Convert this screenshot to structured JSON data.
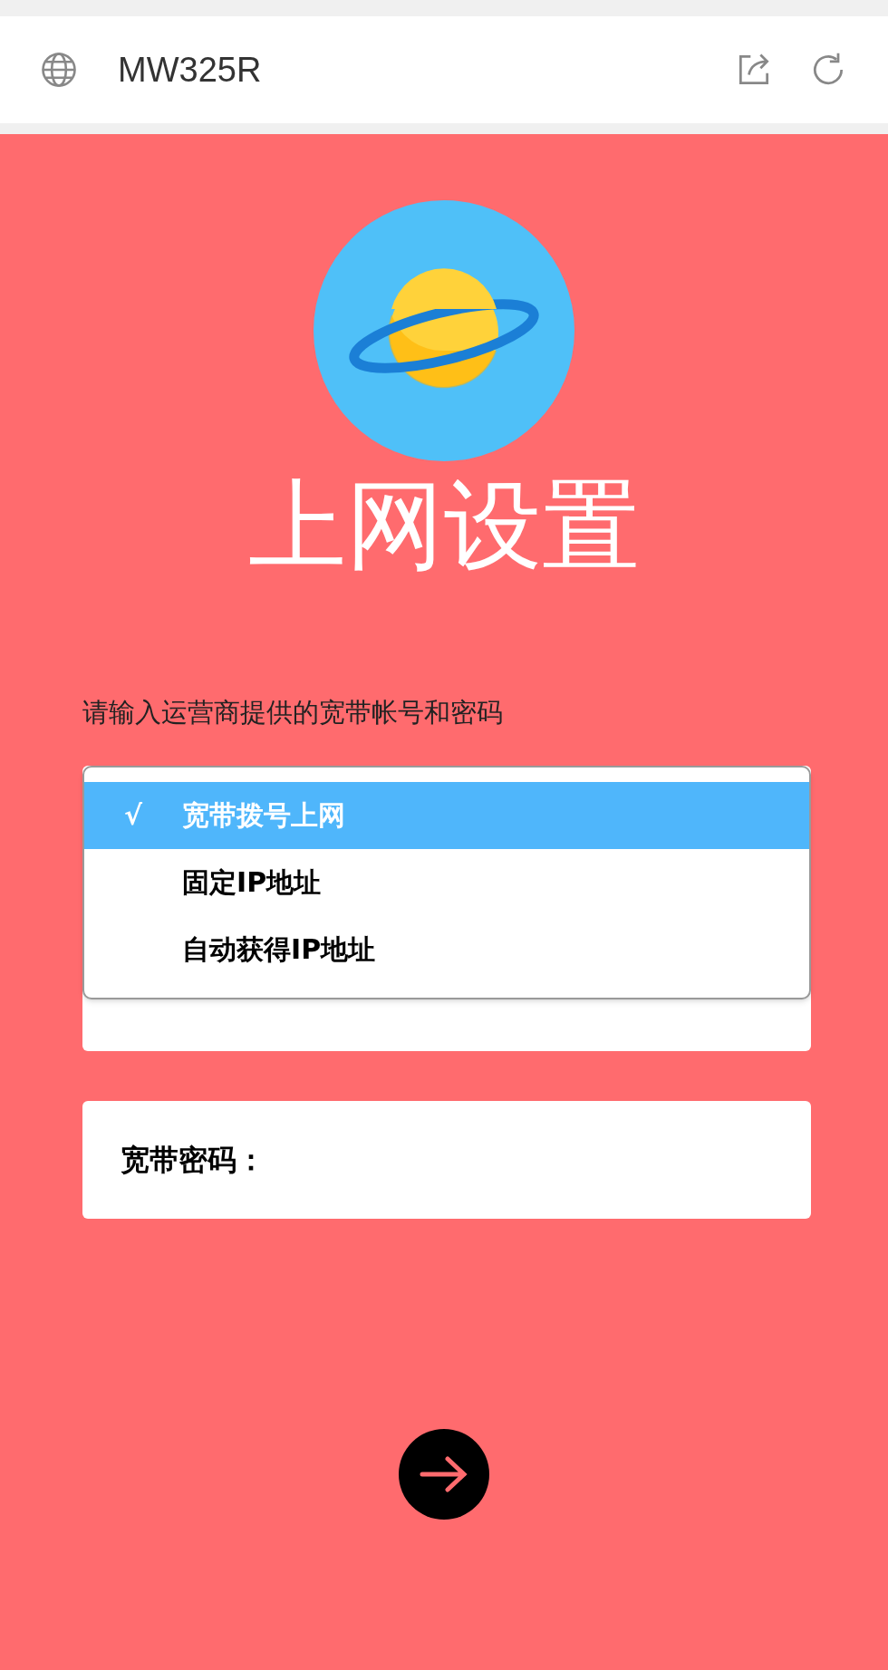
{
  "browser_bar": {
    "title": "MW325R"
  },
  "page": {
    "heading": "上网设置",
    "instruction": "请输入运营商提供的宽带帐号和密码",
    "dropdown": {
      "options": [
        {
          "label": "宽带拨号上网",
          "mark": "√",
          "selected": true
        },
        {
          "label": "固定IP地址",
          "selected": false
        },
        {
          "label": "自动获得IP地址",
          "selected": false
        }
      ]
    },
    "password_field": {
      "label": "宽带密码："
    }
  }
}
